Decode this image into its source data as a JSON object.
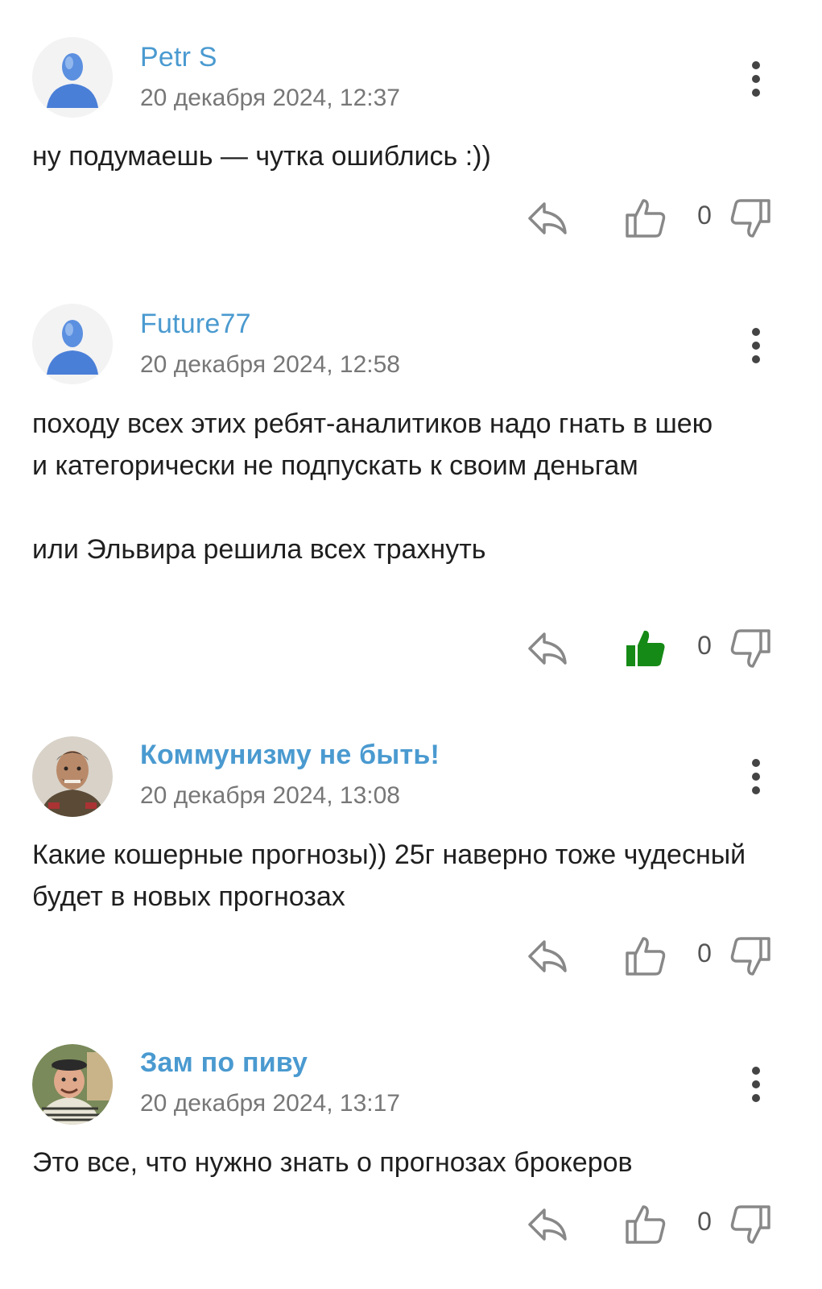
{
  "colors": {
    "author": "#4a9ad0",
    "liked": "#168a16",
    "icon": "#888888"
  },
  "comments": [
    {
      "author": "Petr S",
      "date": "20 декабря 2024, 12:37",
      "text": "ну подумаешь — чутка ошиблись :))",
      "likes": "0",
      "liked": false,
      "avatar": "default-avatar"
    },
    {
      "author": "Future77",
      "date": "20 декабря 2024, 12:58",
      "text": "походу всех этих ребят-аналитиков надо гнать в шею\nи категорически не подпускать к своим деньгам\n\nили Эльвира решила всех трахнуть",
      "likes": "0",
      "liked": true,
      "avatar": "default-avatar"
    },
    {
      "author": "Коммунизму не быть!",
      "date": "20 декабря 2024, 13:08",
      "text": "Какие кошерные прогнозы)) 25г наверно тоже чудесный будет в новых прогнозах",
      "likes": "0",
      "liked": false,
      "avatar": "photo-avatar"
    },
    {
      "author": "Зам по пиву",
      "date": "20 декабря 2024, 13:17",
      "text": "Это все, что нужно знать о прогнозах брокеров",
      "likes": "0",
      "liked": false,
      "avatar": "photo-avatar"
    }
  ]
}
